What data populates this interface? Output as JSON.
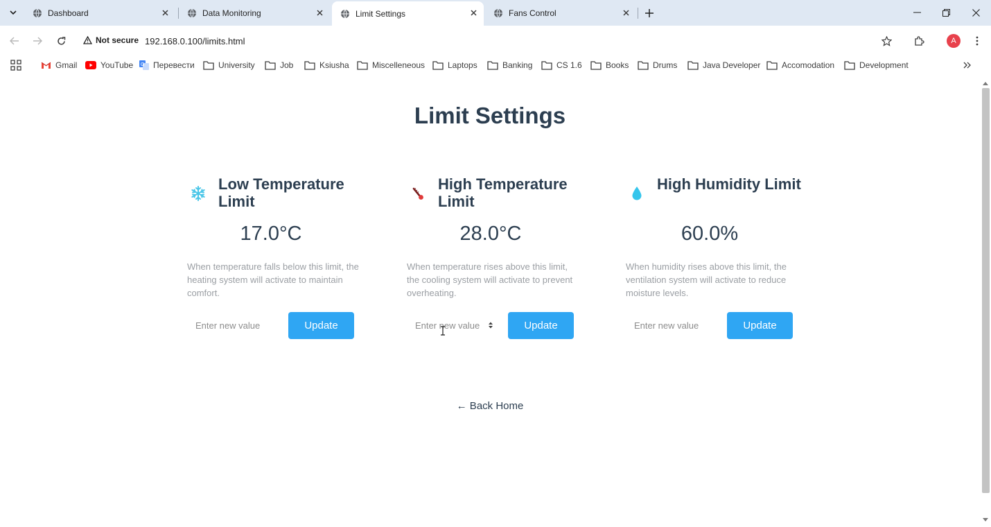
{
  "browser": {
    "tabs": [
      {
        "title": "Dashboard",
        "active": false
      },
      {
        "title": "Data Monitoring",
        "active": false
      },
      {
        "title": "Limit Settings",
        "active": true
      },
      {
        "title": "Fans Control",
        "active": false
      }
    ],
    "address": {
      "security_label": "Not secure",
      "url": "192.168.0.100/limits.html"
    },
    "profile_initial": "A",
    "bookmarks": [
      {
        "label": "Gmail",
        "icon": "gmail-icon"
      },
      {
        "label": "YouTube",
        "icon": "youtube-icon"
      },
      {
        "label": "Перевести",
        "icon": "translate-icon"
      },
      {
        "label": "University",
        "icon": "folder-icon"
      },
      {
        "label": "Job",
        "icon": "folder-icon"
      },
      {
        "label": "Ksiusha",
        "icon": "folder-icon"
      },
      {
        "label": "Miscelleneous",
        "icon": "folder-icon"
      },
      {
        "label": "Laptops",
        "icon": "folder-icon"
      },
      {
        "label": "Banking",
        "icon": "folder-icon"
      },
      {
        "label": "CS 1.6",
        "icon": "folder-icon"
      },
      {
        "label": "Books",
        "icon": "folder-icon"
      },
      {
        "label": "Drums",
        "icon": "folder-icon"
      },
      {
        "label": "Java Developer",
        "icon": "folder-icon"
      },
      {
        "label": "Accomodation",
        "icon": "folder-icon"
      },
      {
        "label": "Development",
        "icon": "folder-icon"
      }
    ]
  },
  "page": {
    "title": "Limit Settings",
    "cards": [
      {
        "icon": "snowflake-icon",
        "title": "Low Temperature Limit",
        "value": "17.0°C",
        "description": "When temperature falls below this limit, the heating system will activate to maintain comfort.",
        "input_placeholder": "Enter new value",
        "button_label": "Update"
      },
      {
        "icon": "thermometer-icon",
        "title": "High Temperature Limit",
        "value": "28.0°C",
        "description": "When temperature rises above this limit, the cooling system will activate to prevent overheating.",
        "input_placeholder": "Enter new value",
        "button_label": "Update"
      },
      {
        "icon": "droplet-icon",
        "title": "High Humidity Limit",
        "value": "60.0%",
        "description": "When humidity rises above this limit, the ventilation system will activate to reduce moisture levels.",
        "input_placeholder": "Enter new value",
        "button_label": "Update"
      }
    ],
    "back_link": "← Back Home"
  },
  "colors": {
    "accent": "#2fa6f3",
    "heading": "#2c3e50",
    "muted_text": "#9a9ea3",
    "tabstrip": "#dfe8f3"
  }
}
